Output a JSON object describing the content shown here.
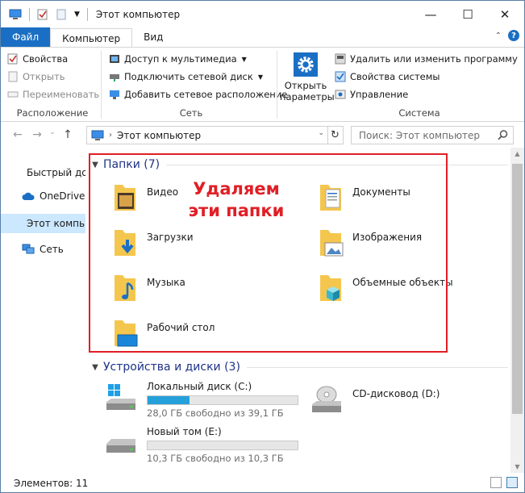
{
  "window": {
    "title": "Этот компьютер",
    "controls": {
      "minimize": "—",
      "maximize": "☐",
      "close": "✕"
    }
  },
  "ribbon_tabs": [
    {
      "label": "Файл"
    },
    {
      "label": "Компьютер"
    },
    {
      "label": "Вид"
    }
  ],
  "ribbon": {
    "location": {
      "label": "Расположение",
      "items": [
        "Свойства",
        "Открыть",
        "Переименовать"
      ]
    },
    "network": {
      "label": "Сеть",
      "items": [
        "Доступ к мультимедиа",
        "Подключить сетевой диск",
        "Добавить сетевое расположение"
      ]
    },
    "open_settings": {
      "line1": "Открыть",
      "line2": "параметры"
    },
    "system": {
      "label": "Система",
      "items": [
        "Удалить или изменить программу",
        "Свойства системы",
        "Управление"
      ]
    }
  },
  "address": {
    "path": "Этот компьютер",
    "search_placeholder": "Поиск: Этот компьютер"
  },
  "nav_pane": [
    "Быстрый доступ",
    "OneDrive",
    "Этот компьютер",
    "Сеть"
  ],
  "folders_section": {
    "header": "Папки (7)",
    "items": [
      "Видео",
      "Документы",
      "Загрузки",
      "Изображения",
      "Музыка",
      "Объемные объекты",
      "Рабочий стол"
    ]
  },
  "annotation": {
    "line1": "Удаляем",
    "line2": "эти папки"
  },
  "devices_section": {
    "header": "Устройства и диски (3)",
    "drives": [
      {
        "name": "Локальный диск (C:)",
        "free": "28,0 ГБ свободно из 39,1 ГБ",
        "used_fraction": 0.28
      },
      {
        "name": "Новый том (E:)",
        "free": "10,3 ГБ свободно из 10,3 ГБ",
        "used_fraction": 0.0
      }
    ],
    "cd": {
      "name": "CD-дисковод (D:)"
    }
  },
  "status": {
    "items": "Элементов: 11"
  },
  "colors": {
    "accent": "#1a6fc4",
    "annotation_red": "#e01f26",
    "folder_yellow": "#f4c64e",
    "selection": "#cce8ff",
    "drive_bar": "#26a0da"
  }
}
